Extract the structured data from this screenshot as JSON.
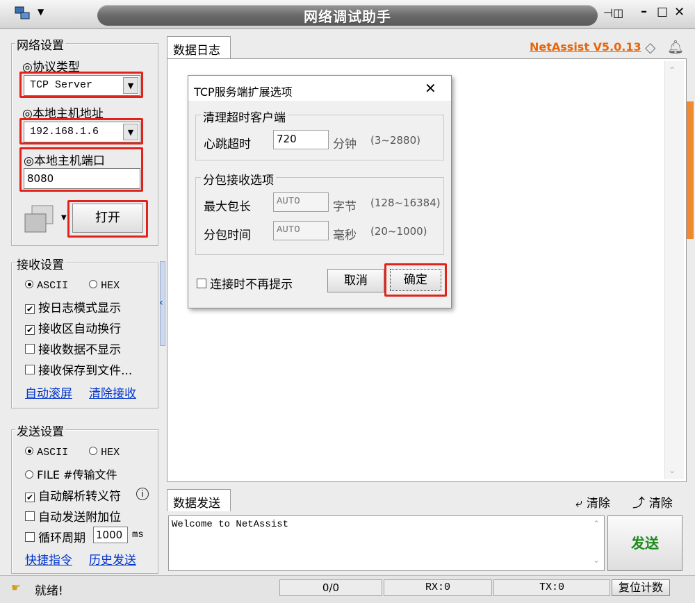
{
  "window": {
    "title": "网络调试助手"
  },
  "network_settings": {
    "group_label": "网络设置",
    "protocol_label": "◎协议类型",
    "protocol_value": "TCP Server",
    "host_label": "◎本地主机地址",
    "host_value": "192.168.1.6",
    "port_label": "◎本地主机端口",
    "port_value": "8080",
    "open_button": "打开"
  },
  "receive_settings": {
    "group_label": "接收设置",
    "ascii": "ASCII",
    "hex": "HEX",
    "log_mode": "按日志模式显示",
    "auto_wrap": "接收区自动换行",
    "hide_data": "接收数据不显示",
    "save_file": "接收保存到文件...",
    "auto_scroll": "自动滚屏",
    "clear_receive": "清除接收"
  },
  "send_settings": {
    "group_label": "发送设置",
    "ascii": "ASCII",
    "hex": "HEX",
    "file": "FILE #传输文件",
    "parse_escape": "自动解析转义符",
    "append_bit": "自动发送附加位",
    "cycle": "循环周期",
    "cycle_value": "1000",
    "cycle_unit": "ms",
    "shortcut": "快捷指令",
    "history": "历史发送"
  },
  "log": {
    "tab": "数据日志",
    "brand": "NetAssist V5.0.13"
  },
  "send": {
    "tab": "数据发送",
    "clear1": "清除",
    "clear2": "清除",
    "text": "Welcome to NetAssist",
    "send_button": "发送"
  },
  "dialog": {
    "title": "TCP服务端扩展选项",
    "group1": "清理超时客户端",
    "heartbeat_label": "心跳超时",
    "heartbeat_value": "720",
    "heartbeat_unit": "分钟",
    "heartbeat_range": "(3~2880)",
    "group2": "分包接收选项",
    "maxlen_label": "最大包长",
    "maxlen_value": "AUTO",
    "maxlen_unit": "字节",
    "maxlen_range": "(128~16384)",
    "time_label": "分包时间",
    "time_value": "AUTO",
    "time_unit": "毫秒",
    "time_range": "(20~1000)",
    "no_prompt": "连接时不再提示",
    "cancel": "取消",
    "ok": "确定"
  },
  "status": {
    "ready": "就绪!",
    "counter": "0/0",
    "rx": "RX:0",
    "tx": "TX:0",
    "reset": "复位计数"
  },
  "colors": {
    "accent_red": "#e3231b",
    "brand_orange": "#e8650a",
    "send_green": "#1a8a1a"
  }
}
